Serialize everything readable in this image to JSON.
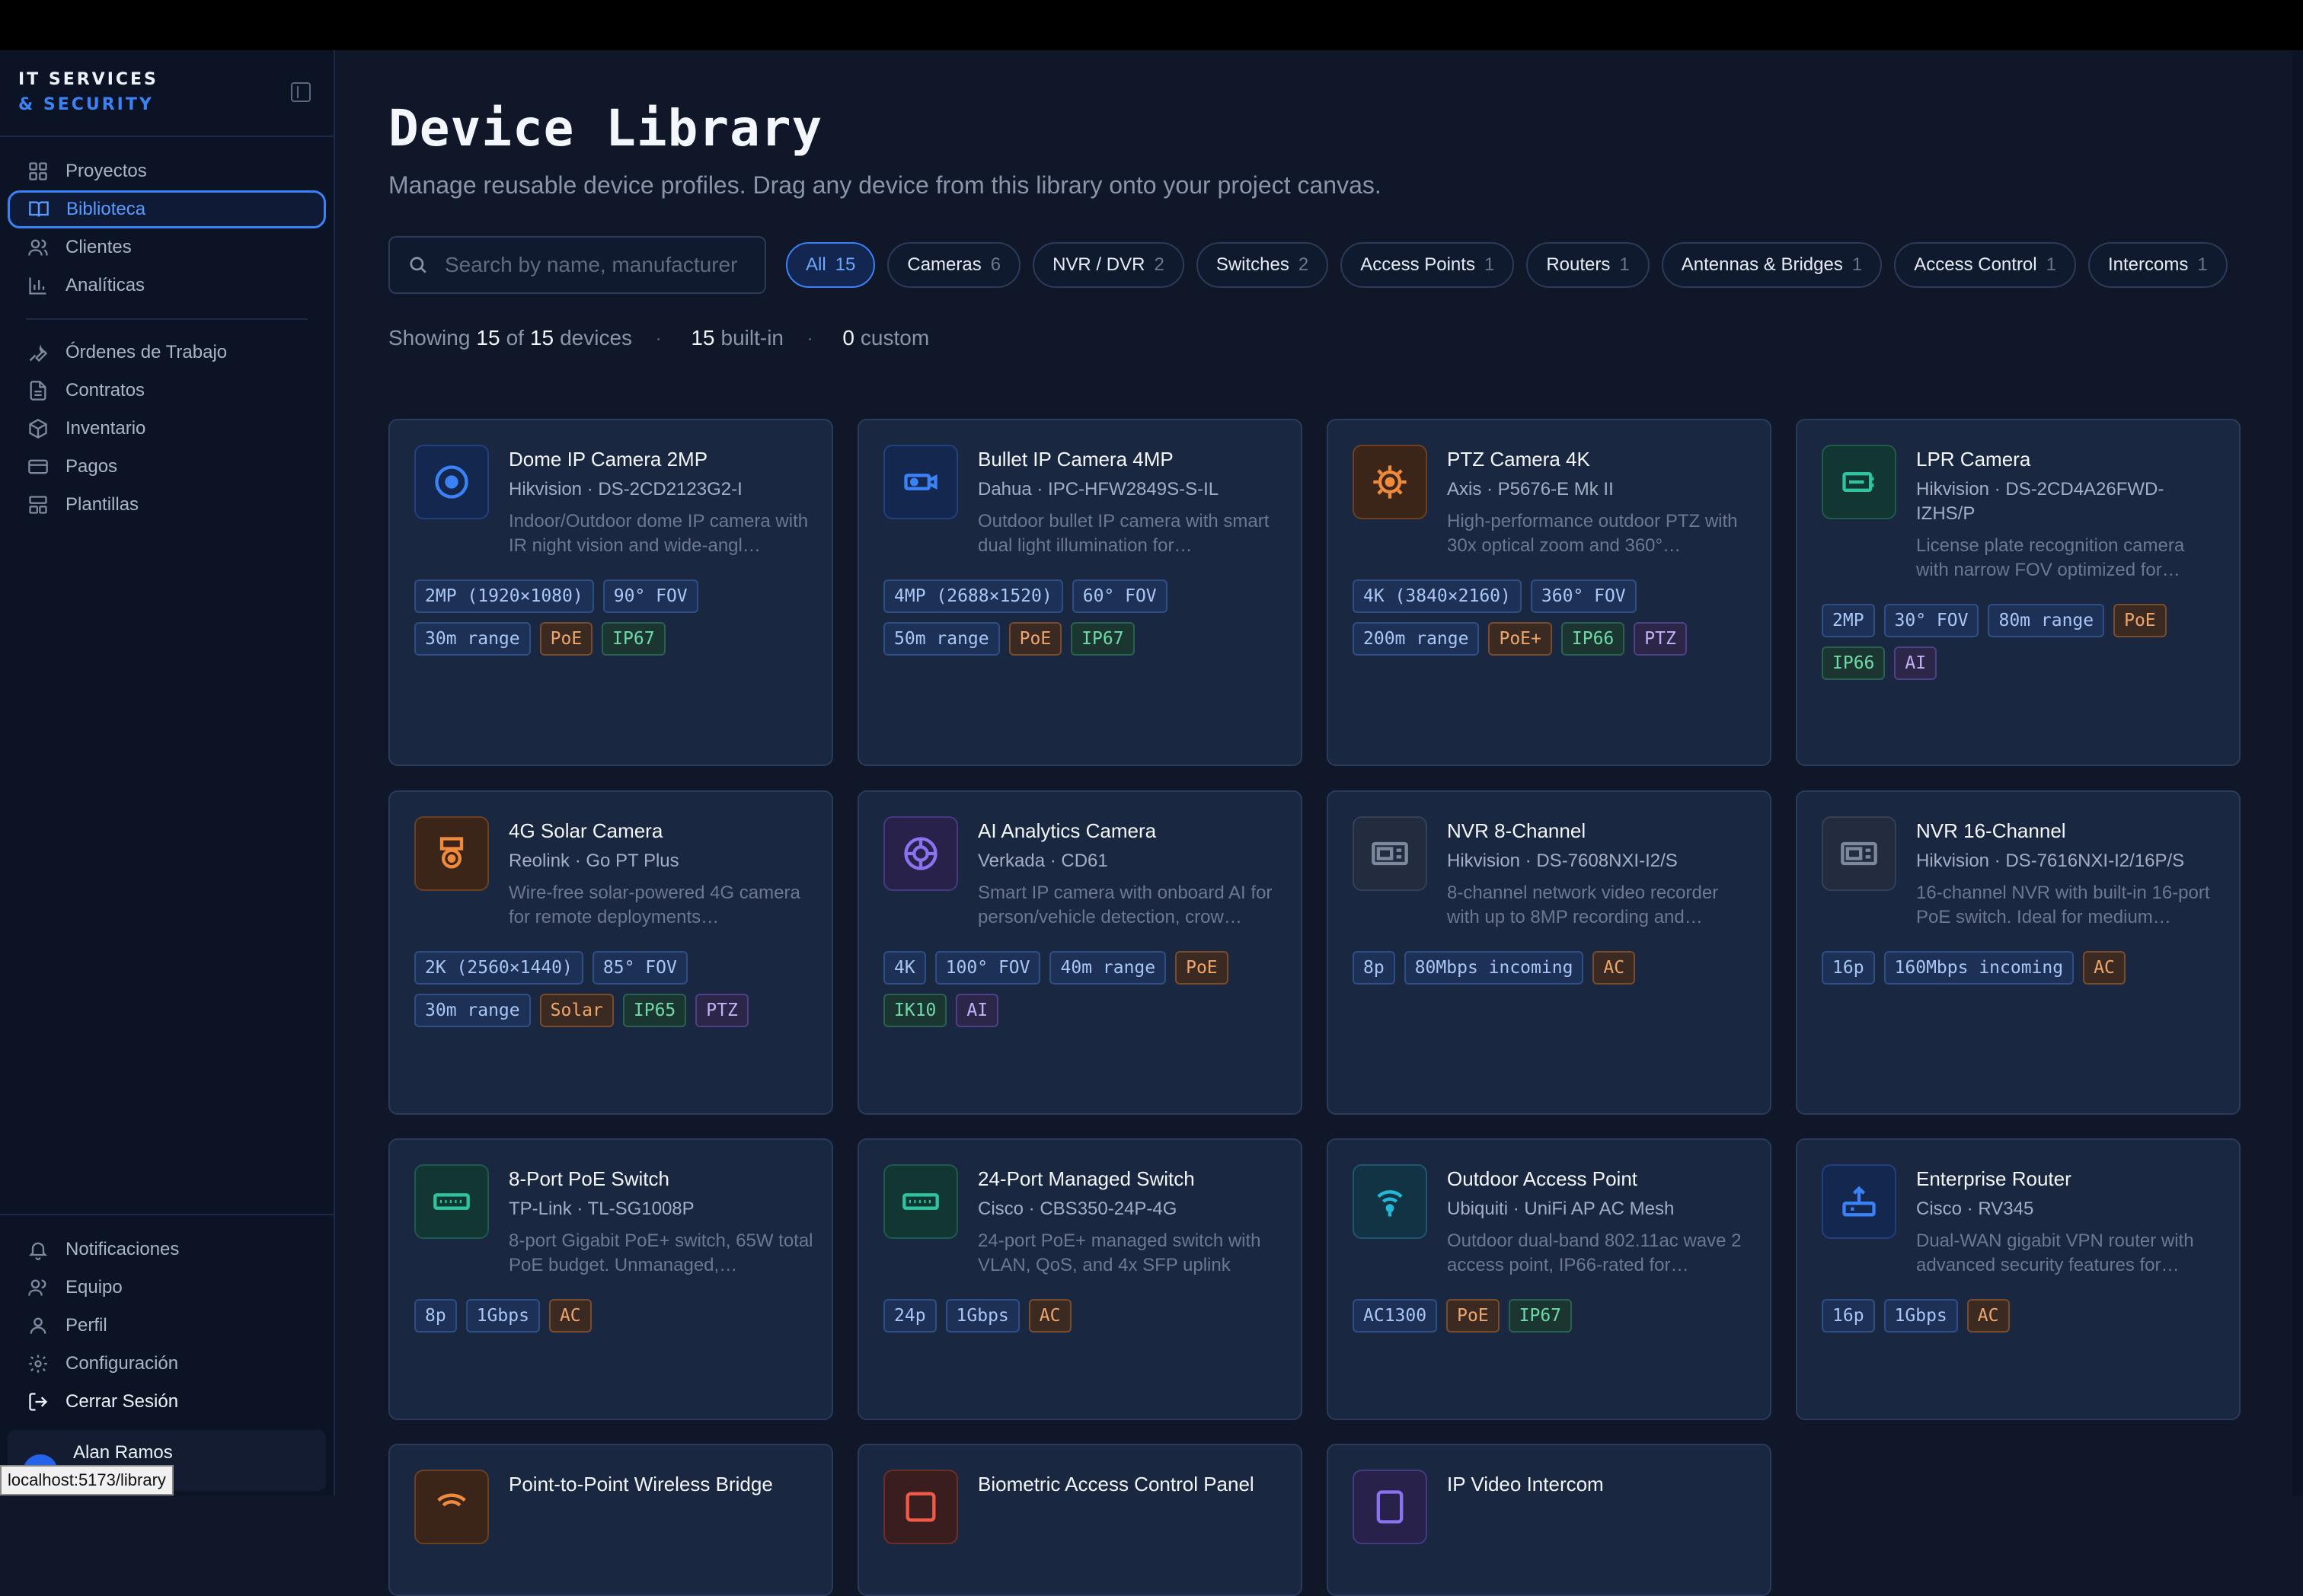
{
  "brand": {
    "line1": "IT SERVICES",
    "line2": "& SECURITY"
  },
  "nav": {
    "primary": [
      {
        "label": "Proyectos",
        "icon": "grid-icon"
      },
      {
        "label": "Biblioteca",
        "icon": "book-icon",
        "active": true
      },
      {
        "label": "Clientes",
        "icon": "users-icon"
      },
      {
        "label": "Analíticas",
        "icon": "bar-chart-icon"
      }
    ],
    "secondary": [
      {
        "label": "Órdenes de Trabajo",
        "icon": "wrench-icon"
      },
      {
        "label": "Contratos",
        "icon": "document-icon"
      },
      {
        "label": "Inventario",
        "icon": "package-icon"
      },
      {
        "label": "Pagos",
        "icon": "credit-card-icon"
      },
      {
        "label": "Plantillas",
        "icon": "template-icon"
      }
    ],
    "bottom": [
      {
        "label": "Notificaciones",
        "icon": "bell-icon"
      },
      {
        "label": "Equipo",
        "icon": "team-icon"
      },
      {
        "label": "Perfil",
        "icon": "user-icon"
      },
      {
        "label": "Configuración",
        "icon": "gear-icon"
      },
      {
        "label": "Cerrar Sesión",
        "icon": "logout-icon"
      }
    ]
  },
  "user": {
    "initial": "A",
    "name": "Alan Ramos"
  },
  "status_url": "localhost:5173/library",
  "page": {
    "title": "Device Library",
    "subtitle": "Manage reusable device profiles. Drag any device from this library onto your project canvas."
  },
  "search": {
    "placeholder": "Search by name, manufacturer",
    "value": ""
  },
  "filters": [
    {
      "label": "All",
      "count": "15",
      "active": true
    },
    {
      "label": "Cameras",
      "count": "6"
    },
    {
      "label": "NVR / DVR",
      "count": "2"
    },
    {
      "label": "Switches",
      "count": "2"
    },
    {
      "label": "Access Points",
      "count": "1"
    },
    {
      "label": "Routers",
      "count": "1"
    },
    {
      "label": "Antennas & Bridges",
      "count": "1"
    },
    {
      "label": "Access Control",
      "count": "1"
    },
    {
      "label": "Intercoms",
      "count": "1"
    }
  ],
  "stats": {
    "showing_label": "Showing",
    "shown": "15",
    "of_label": "of",
    "total": "15",
    "devices_label": "devices",
    "builtin": "15",
    "builtin_label": "built-in",
    "custom": "0",
    "custom_label": "custom",
    "separator": "·"
  },
  "devices": [
    {
      "name": "Dome IP Camera 2MP",
      "maker": "Hikvision · DS-2CD2123G2-I",
      "desc": "Indoor/Outdoor dome IP camera with IR night vision and wide-angl…",
      "icon": "dome-camera-icon",
      "color": "blue",
      "tags": [
        [
          "2MP (1920×1080)",
          "blue"
        ],
        [
          "90° FOV",
          "blue"
        ],
        [
          "30m range",
          "blue"
        ],
        [
          "PoE",
          "orange"
        ],
        [
          "IP67",
          "green"
        ]
      ]
    },
    {
      "name": "Bullet IP Camera 4MP",
      "maker": "Dahua · IPC-HFW2849S-S-IL",
      "desc": "Outdoor bullet IP camera with smart dual light illumination for…",
      "icon": "bullet-camera-icon",
      "color": "blue",
      "tags": [
        [
          "4MP (2688×1520)",
          "blue"
        ],
        [
          "60° FOV",
          "blue"
        ],
        [
          "50m range",
          "blue"
        ],
        [
          "PoE",
          "orange"
        ],
        [
          "IP67",
          "green"
        ]
      ]
    },
    {
      "name": "PTZ Camera 4K",
      "maker": "Axis · P5676-E Mk II",
      "desc": "High-performance outdoor PTZ with 30x optical zoom and 360°…",
      "icon": "ptz-camera-icon",
      "color": "orange",
      "tags": [
        [
          "4K (3840×2160)",
          "blue"
        ],
        [
          "360° FOV",
          "blue"
        ],
        [
          "200m range",
          "blue"
        ],
        [
          "PoE+",
          "orange"
        ],
        [
          "IP66",
          "green"
        ],
        [
          "PTZ",
          "purple"
        ]
      ]
    },
    {
      "name": "LPR Camera",
      "maker": "Hikvision · DS-2CD4A26FWD-IZHS/P",
      "desc": "License plate recognition camera with narrow FOV optimized for…",
      "icon": "lpr-camera-icon",
      "color": "teal",
      "tags": [
        [
          "2MP",
          "blue"
        ],
        [
          "30° FOV",
          "blue"
        ],
        [
          "80m range",
          "blue"
        ],
        [
          "PoE",
          "orange"
        ],
        [
          "IP66",
          "green"
        ],
        [
          "AI",
          "purple"
        ]
      ]
    },
    {
      "name": "4G Solar Camera",
      "maker": "Reolink · Go PT Plus",
      "desc": "Wire-free solar-powered 4G camera for remote deployments…",
      "icon": "solar-camera-icon",
      "color": "orange",
      "tags": [
        [
          "2K (2560×1440)",
          "blue"
        ],
        [
          "85° FOV",
          "blue"
        ],
        [
          "30m range",
          "blue"
        ],
        [
          "Solar",
          "orange"
        ],
        [
          "IP65",
          "green"
        ],
        [
          "PTZ",
          "purple"
        ]
      ]
    },
    {
      "name": "AI Analytics Camera",
      "maker": "Verkada · CD61",
      "desc": "Smart IP camera with onboard AI for person/vehicle detection, crow…",
      "icon": "ai-camera-icon",
      "color": "purple",
      "tags": [
        [
          "4K",
          "blue"
        ],
        [
          "100° FOV",
          "blue"
        ],
        [
          "40m range",
          "blue"
        ],
        [
          "PoE",
          "orange"
        ],
        [
          "IK10",
          "green"
        ],
        [
          "AI",
          "purple"
        ]
      ]
    },
    {
      "name": "NVR 8-Channel",
      "maker": "Hikvision · DS-7608NXI-I2/S",
      "desc": "8-channel network video recorder with up to 8MP recording and…",
      "icon": "nvr-icon",
      "color": "gray",
      "tags": [
        [
          "8p",
          "blue"
        ],
        [
          "80Mbps incoming",
          "blue"
        ],
        [
          "AC",
          "orange"
        ]
      ]
    },
    {
      "name": "NVR 16-Channel",
      "maker": "Hikvision · DS-7616NXI-I2/16P/S",
      "desc": "16-channel NVR with built-in 16-port PoE switch. Ideal for medium…",
      "icon": "nvr-icon",
      "color": "gray",
      "tags": [
        [
          "16p",
          "blue"
        ],
        [
          "160Mbps incoming",
          "blue"
        ],
        [
          "AC",
          "orange"
        ]
      ]
    },
    {
      "name": "8-Port PoE Switch",
      "maker": "TP-Link · TL-SG1008P",
      "desc": "8-port Gigabit PoE+ switch, 65W total PoE budget. Unmanaged,…",
      "icon": "switch-icon",
      "color": "teal",
      "tags": [
        [
          "8p",
          "blue"
        ],
        [
          "1Gbps",
          "blue"
        ],
        [
          "AC",
          "orange"
        ]
      ]
    },
    {
      "name": "24-Port Managed Switch",
      "maker": "Cisco · CBS350-24P-4G",
      "desc": "24-port PoE+ managed switch with VLAN, QoS, and 4x SFP uplink port…",
      "icon": "switch-icon",
      "color": "teal",
      "tags": [
        [
          "24p",
          "blue"
        ],
        [
          "1Gbps",
          "blue"
        ],
        [
          "AC",
          "orange"
        ]
      ]
    },
    {
      "name": "Outdoor Access Point",
      "maker": "Ubiquiti · UniFi AP AC Mesh",
      "desc": "Outdoor dual-band 802.11ac wave 2 access point, IP66-rated for…",
      "icon": "wifi-icon",
      "color": "cyan",
      "tags": [
        [
          "AC1300",
          "blue"
        ],
        [
          "PoE",
          "orange"
        ],
        [
          "IP67",
          "green"
        ]
      ]
    },
    {
      "name": "Enterprise Router",
      "maker": "Cisco · RV345",
      "desc": "Dual-WAN gigabit VPN router with advanced security features for…",
      "icon": "router-icon",
      "color": "blue",
      "tags": [
        [
          "16p",
          "blue"
        ],
        [
          "1Gbps",
          "blue"
        ],
        [
          "AC",
          "orange"
        ]
      ]
    },
    {
      "name": "Point-to-Point Wireless Bridge",
      "maker": "",
      "desc": "",
      "icon": "antenna-icon",
      "color": "orange",
      "tags": []
    },
    {
      "name": "Biometric Access Control Panel",
      "maker": "",
      "desc": "",
      "icon": "fingerprint-icon",
      "color": "red",
      "tags": []
    },
    {
      "name": "IP Video Intercom",
      "maker": "",
      "desc": "",
      "icon": "intercom-icon",
      "color": "purple",
      "tags": []
    }
  ]
}
